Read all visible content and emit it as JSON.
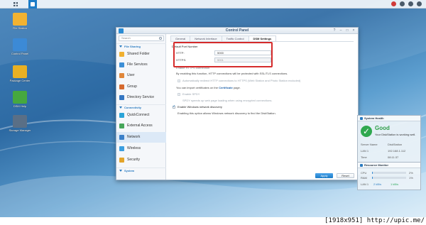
{
  "taskbar": {
    "apps_icon": "grid-icon",
    "active_app_icon": "control-panel-icon",
    "tray": [
      {
        "name": "notification-icon",
        "color": "#d03a3a",
        "glyph": "●"
      },
      {
        "name": "user-icon",
        "color": "#4a5a6a",
        "glyph": "●"
      },
      {
        "name": "search-icon",
        "color": "#4a5a6a",
        "glyph": "●"
      },
      {
        "name": "options-icon",
        "color": "#4a5a6a",
        "glyph": "●"
      }
    ]
  },
  "desktop": {
    "icons": [
      {
        "label": "File Station",
        "color": "#f2b230"
      },
      {
        "label": "Control Panel",
        "color": "#3c8ad6"
      },
      {
        "label": "Package Center",
        "color": "#e8b023"
      },
      {
        "label": "DSM Help",
        "color": "#46a83f"
      },
      {
        "label": "Storage Manager",
        "color": "#5a6f86"
      }
    ]
  },
  "window": {
    "title": "Control Panel",
    "search_placeholder": "Search",
    "sections": [
      {
        "label": "File Sharing"
      },
      {
        "label": "Connectivity"
      },
      {
        "label": "System"
      }
    ],
    "nav": [
      {
        "label": "Shared Folder",
        "color": "#f0b030"
      },
      {
        "label": "File Services",
        "color": "#3d8fd6"
      },
      {
        "label": "User",
        "color": "#e0873a"
      },
      {
        "label": "Group",
        "color": "#d66a2f"
      },
      {
        "label": "Directory Service",
        "color": "#3577c2"
      },
      {
        "label": "QuickConnect",
        "color": "#2aa4d8"
      },
      {
        "label": "External Access",
        "color": "#46a65a"
      },
      {
        "label": "Network",
        "color": "#3a80c9"
      },
      {
        "label": "Wireless",
        "color": "#3b9fe0"
      },
      {
        "label": "Security",
        "color": "#e3a42a"
      }
    ],
    "tabs": [
      "General",
      "Network Interface",
      "Traffic Control",
      "DSM Settings"
    ],
    "active_tab": "DSM Settings",
    "pane": {
      "default_port_heading": "Default Port Number",
      "http_label": "HTTP:",
      "http_value": "5000",
      "https_label": "HTTPS:",
      "https_value": "5001",
      "https_heading": "Enable HTTPS connection",
      "https_desc": "By enabling this function, HTTP connections will be protected with SSL/TLS connections.",
      "redirect_label": "Automatically redirect HTTP connections to HTTPS (Web Station and Photo Station excluded)",
      "cert_text_prefix": "You can import certificates on the",
      "cert_link": "Certificate",
      "cert_text_suffix": "page.",
      "spdy_label": "Enable SPDY",
      "spdy_desc": "SPDY speeds up web page loading when using encrypted connections.",
      "discovery_label": "Enable Windows network discovery",
      "discovery_desc": "Enabling this option allows Windows network discovery to find the DiskStation."
    },
    "apply_label": "Apply",
    "reset_label": "Reset"
  },
  "health_widget": {
    "title": "System Health",
    "status": "Good",
    "status_sub": "Your DiskStation is working well.",
    "rows": [
      {
        "key": "Server Name",
        "value": "DiskStation"
      },
      {
        "key": "LAN 1",
        "value": "192.168.1.112"
      },
      {
        "key": "Time",
        "value": "08:11:37"
      }
    ]
  },
  "resource_widget": {
    "title": "Resource Monitor",
    "cpu_label": "CPU",
    "cpu_value": "2%",
    "cpu_level": 0.02,
    "ram_label": "RAM",
    "ram_value": "1%",
    "ram_level": 0.01,
    "lan_label": "LAN 1",
    "lan_up": "2 kB/s",
    "lan_down": "1 kB/s"
  },
  "footer_credit": "[1918x951] http://upic.me/"
}
